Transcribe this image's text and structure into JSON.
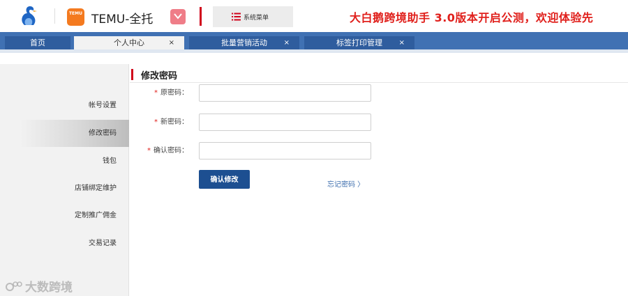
{
  "header": {
    "temu_logo_text": "TEMU",
    "brand": "TEMU-全托",
    "heart_icon": "heart-icon",
    "system_menu_label": "系统菜单",
    "system_menu_icon": "list-icon",
    "announcement": "大白鹅跨境助手 3.0版本开启公测，欢迎体验先",
    "accent_color": "#d0021b"
  },
  "tabs": [
    {
      "label": "首页",
      "closable": false
    },
    {
      "label": "个人中心",
      "closable": true,
      "active": true
    },
    {
      "label": "批量营销活动",
      "closable": true
    },
    {
      "label": "标签打印管理",
      "closable": true
    }
  ],
  "tab_close_glyph": "×",
  "sidebar": {
    "items": [
      {
        "label": "帐号设置"
      },
      {
        "label": "修改密码",
        "active": true
      },
      {
        "label": "钱包"
      },
      {
        "label": "店铺绑定维护"
      },
      {
        "label": "定制推广佣金"
      },
      {
        "label": "交易记录"
      }
    ]
  },
  "main": {
    "title": "修改密码",
    "required_mark": "*",
    "fields": [
      {
        "label": "原密码：",
        "value": "",
        "placeholder": ""
      },
      {
        "label": "新密码：",
        "value": "",
        "placeholder": ""
      },
      {
        "label": "确认密码：",
        "value": "",
        "placeholder": ""
      }
    ],
    "submit_label": "确认修改",
    "forgot_label": "忘记密码 〉"
  },
  "watermark": {
    "text": "大数跨境",
    "icon": "logo-mark-icon"
  }
}
